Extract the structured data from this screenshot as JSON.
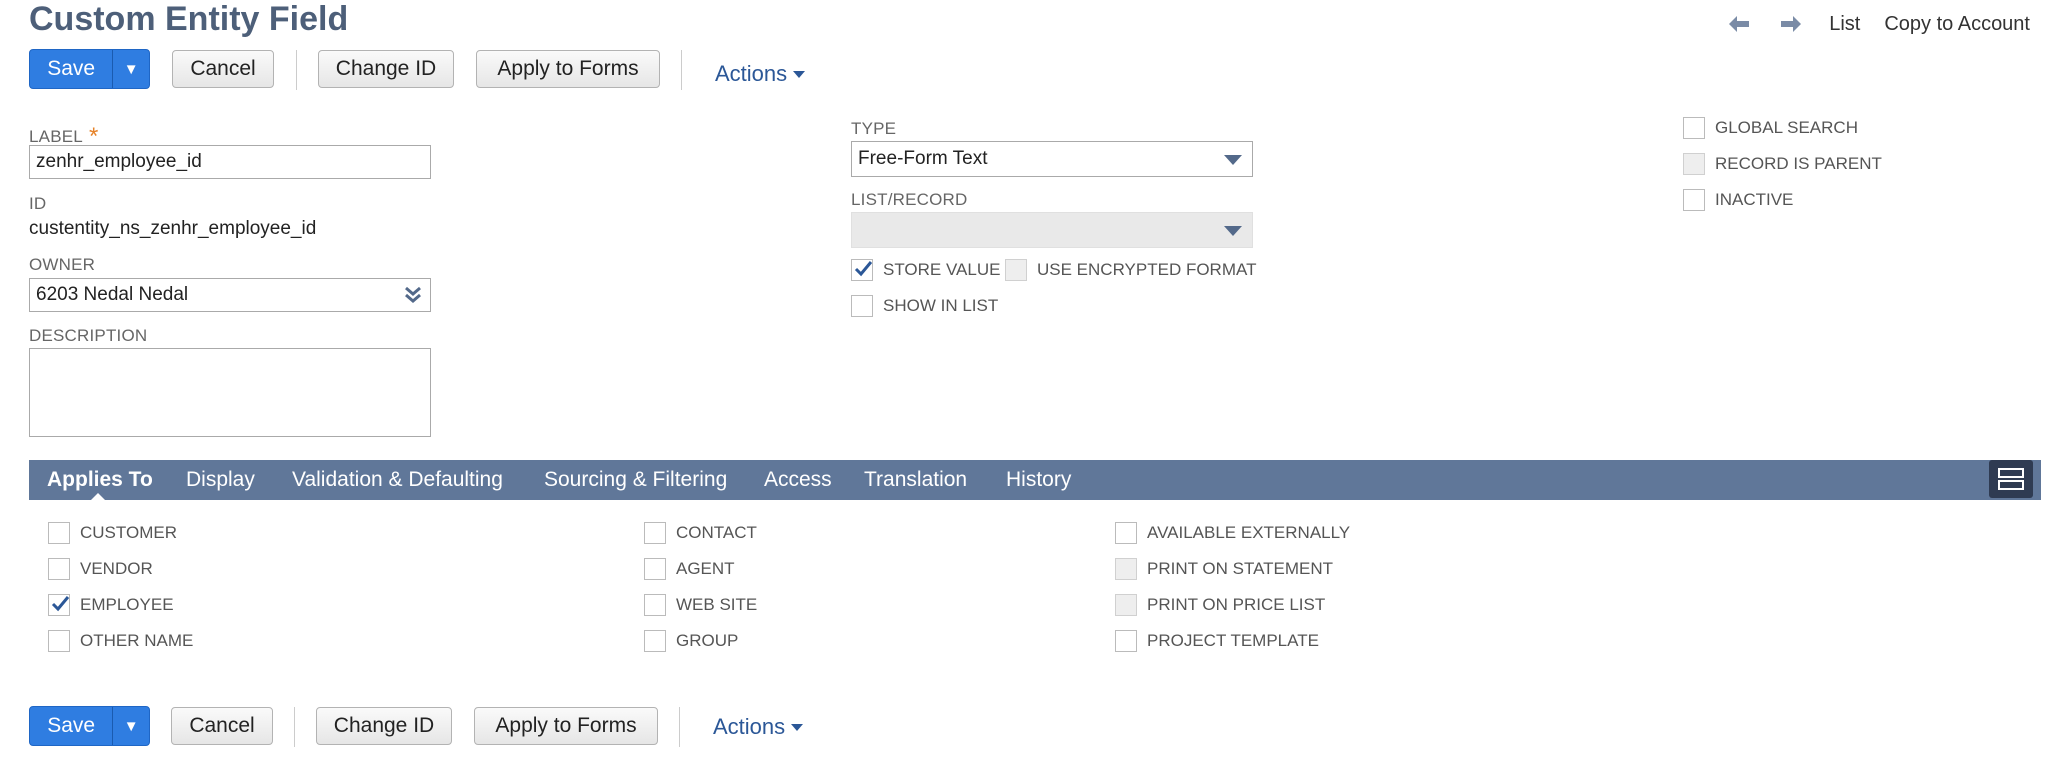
{
  "page": {
    "title": "Custom Entity Field",
    "top_links": {
      "list": "List",
      "copy_to_account": "Copy to Account"
    }
  },
  "toolbar": {
    "save": "Save",
    "cancel": "Cancel",
    "change_id": "Change ID",
    "apply_to_forms": "Apply to Forms",
    "actions": "Actions"
  },
  "form": {
    "label": {
      "label": "LABEL",
      "value": "zenhr_employee_id",
      "required_mark": "*"
    },
    "id": {
      "label": "ID",
      "value": "custentity_ns_zenhr_employee_id"
    },
    "owner": {
      "label": "OWNER",
      "value": "6203 Nedal Nedal"
    },
    "description": {
      "label": "DESCRIPTION",
      "value": ""
    },
    "type": {
      "label": "TYPE",
      "value": "Free-Form Text"
    },
    "list_record": {
      "label": "LIST/RECORD",
      "value": ""
    },
    "store_value": {
      "label": "STORE VALUE",
      "checked": true
    },
    "use_encrypted_format": {
      "label": "USE ENCRYPTED FORMAT",
      "checked": false
    },
    "show_in_list": {
      "label": "SHOW IN LIST",
      "checked": false
    },
    "global_search": {
      "label": "GLOBAL SEARCH",
      "checked": false
    },
    "record_is_parent": {
      "label": "RECORD IS PARENT",
      "checked": false
    },
    "inactive": {
      "label": "INACTIVE",
      "checked": false
    }
  },
  "tabs": [
    {
      "label": "Applies To",
      "active": true
    },
    {
      "label": "Display"
    },
    {
      "label": "Validation & Defaulting"
    },
    {
      "label": "Sourcing & Filtering"
    },
    {
      "label": "Access"
    },
    {
      "label": "Translation"
    },
    {
      "label": "History"
    }
  ],
  "applies_to": {
    "customer": {
      "label": "CUSTOMER",
      "checked": false
    },
    "vendor": {
      "label": "VENDOR",
      "checked": false
    },
    "employee": {
      "label": "EMPLOYEE",
      "checked": true
    },
    "other_name": {
      "label": "OTHER NAME",
      "checked": false
    },
    "contact": {
      "label": "CONTACT",
      "checked": false
    },
    "agent": {
      "label": "AGENT",
      "checked": false
    },
    "web_site": {
      "label": "WEB SITE",
      "checked": false
    },
    "group": {
      "label": "GROUP",
      "checked": false
    },
    "available_externally": {
      "label": "AVAILABLE EXTERNALLY",
      "checked": false
    },
    "print_on_statement": {
      "label": "PRINT ON STATEMENT",
      "checked": false
    },
    "print_on_price_list": {
      "label": "PRINT ON PRICE LIST",
      "checked": false
    },
    "project_template": {
      "label": "PROJECT TEMPLATE",
      "checked": false
    }
  },
  "colors": {
    "accent": "#2f7de1",
    "tabbar": "#607799",
    "title": "#4d5f79",
    "link": "#2b5797"
  }
}
